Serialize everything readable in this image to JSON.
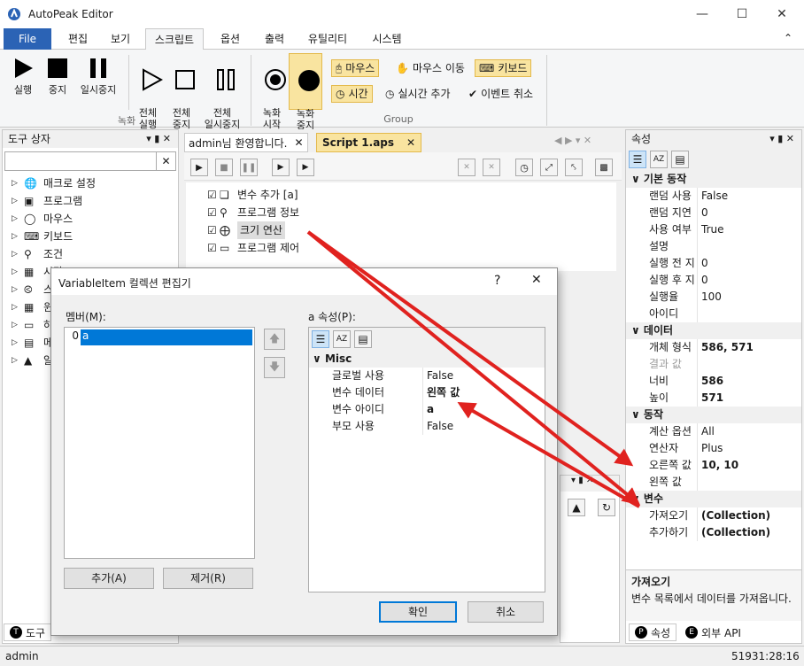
{
  "app": {
    "title": "AutoPeak Editor"
  },
  "ribbon": {
    "tabs": [
      {
        "label": "File"
      },
      {
        "label": "편집"
      },
      {
        "label": "보기"
      },
      {
        "label": "스크립트"
      },
      {
        "label": "옵션"
      },
      {
        "label": "출력"
      },
      {
        "label": "유틸리티"
      },
      {
        "label": "시스템"
      }
    ],
    "run": {
      "label": "실행"
    },
    "stop": {
      "label": "중지"
    },
    "pause": {
      "label": "일시중지"
    },
    "run_all": {
      "label": "전체\n실행"
    },
    "stop_all": {
      "label": "전체\n중지"
    },
    "pause_all": {
      "label": "전체\n일시중지"
    },
    "rec_start": {
      "label": "녹화\n시작"
    },
    "rec_stop": {
      "label": "녹화\n중지"
    },
    "mouse": "마우스",
    "mouse_move": "마우스 이동",
    "keyboard": "키보드",
    "time": "시간",
    "realtime_add": "실시간 추가",
    "event_cancel": "이벤트 취소",
    "group_record": "녹화",
    "group_group": "Group"
  },
  "toolbox": {
    "title": "도구 상자",
    "items": [
      {
        "label": "매크로 설정"
      },
      {
        "label": "프로그램"
      },
      {
        "label": "마우스"
      },
      {
        "label": "키보드"
      },
      {
        "label": "조건"
      },
      {
        "label": "시간"
      },
      {
        "label": "스"
      },
      {
        "label": "윈"
      },
      {
        "label": "하"
      },
      {
        "label": "메"
      },
      {
        "label": "알"
      }
    ],
    "bottom_tab": "도구"
  },
  "doc_tabs": [
    {
      "label": "admin님 환영합니다."
    },
    {
      "label": "Script 1.aps"
    }
  ],
  "script": {
    "items": [
      {
        "label": "변수 추가 [a]"
      },
      {
        "label": "프로그램 정보"
      },
      {
        "label": "크기 연산"
      },
      {
        "label": "프로그램 제어"
      }
    ]
  },
  "properties": {
    "title": "속성",
    "categories": [
      {
        "name": "기본 동작",
        "rows": [
          {
            "k": "랜덤 사용",
            "v": "False"
          },
          {
            "k": "랜덤 지연",
            "v": "0"
          },
          {
            "k": "사용 여부",
            "v": "True"
          },
          {
            "k": "설명",
            "v": ""
          },
          {
            "k": "실행 전 지",
            "v": "0"
          },
          {
            "k": "실행 후 지",
            "v": "0"
          },
          {
            "k": "실행율",
            "v": "100"
          },
          {
            "k": "아이디",
            "v": ""
          }
        ]
      },
      {
        "name": "데이터",
        "rows": [
          {
            "k": "개체 형식",
            "v": "586, 571"
          },
          {
            "k": "결과 값",
            "v": ""
          },
          {
            "k": "너비",
            "v": "586"
          },
          {
            "k": "높이",
            "v": "571"
          }
        ]
      },
      {
        "name": "동작",
        "rows": [
          {
            "k": "계산 옵션",
            "v": "All"
          },
          {
            "k": "연산자",
            "v": "Plus"
          },
          {
            "k": "오른쪽 값",
            "v": "10, 10"
          },
          {
            "k": "왼쪽 값",
            "v": ""
          }
        ]
      },
      {
        "name": "변수",
        "rows": [
          {
            "k": "가져오기",
            "v": "(Collection)"
          },
          {
            "k": "추가하기",
            "v": "(Collection)"
          }
        ]
      }
    ],
    "desc_title": "가져오기",
    "desc_text": "변수 목록에서 데이터를 가져옵니다.",
    "tab_props": "속성",
    "tab_api": "외부 API"
  },
  "dialog": {
    "title": "VariableItem 컬렉션 편집기",
    "help": "?",
    "members_label": "멤버(M):",
    "members": [
      {
        "index": "0",
        "name": "a"
      }
    ],
    "props_label": "a 속성(P):",
    "category": "Misc",
    "rows": [
      {
        "k": "글로벌 사용",
        "v": "False"
      },
      {
        "k": "변수 데이터",
        "v": "왼쪽 값"
      },
      {
        "k": "변수 아이디",
        "v": "a"
      },
      {
        "k": "부모 사용",
        "v": "False"
      }
    ],
    "add": "추가(A)",
    "remove": "제거(R)",
    "ok": "확인",
    "cancel": "취소"
  },
  "status": {
    "user": "admin",
    "time": "51931:28:16"
  },
  "colors": {
    "accent": "#2b63b5",
    "selection": "#0078d7",
    "arrow": "#e0221f",
    "highlight": "#f9e4a0"
  }
}
